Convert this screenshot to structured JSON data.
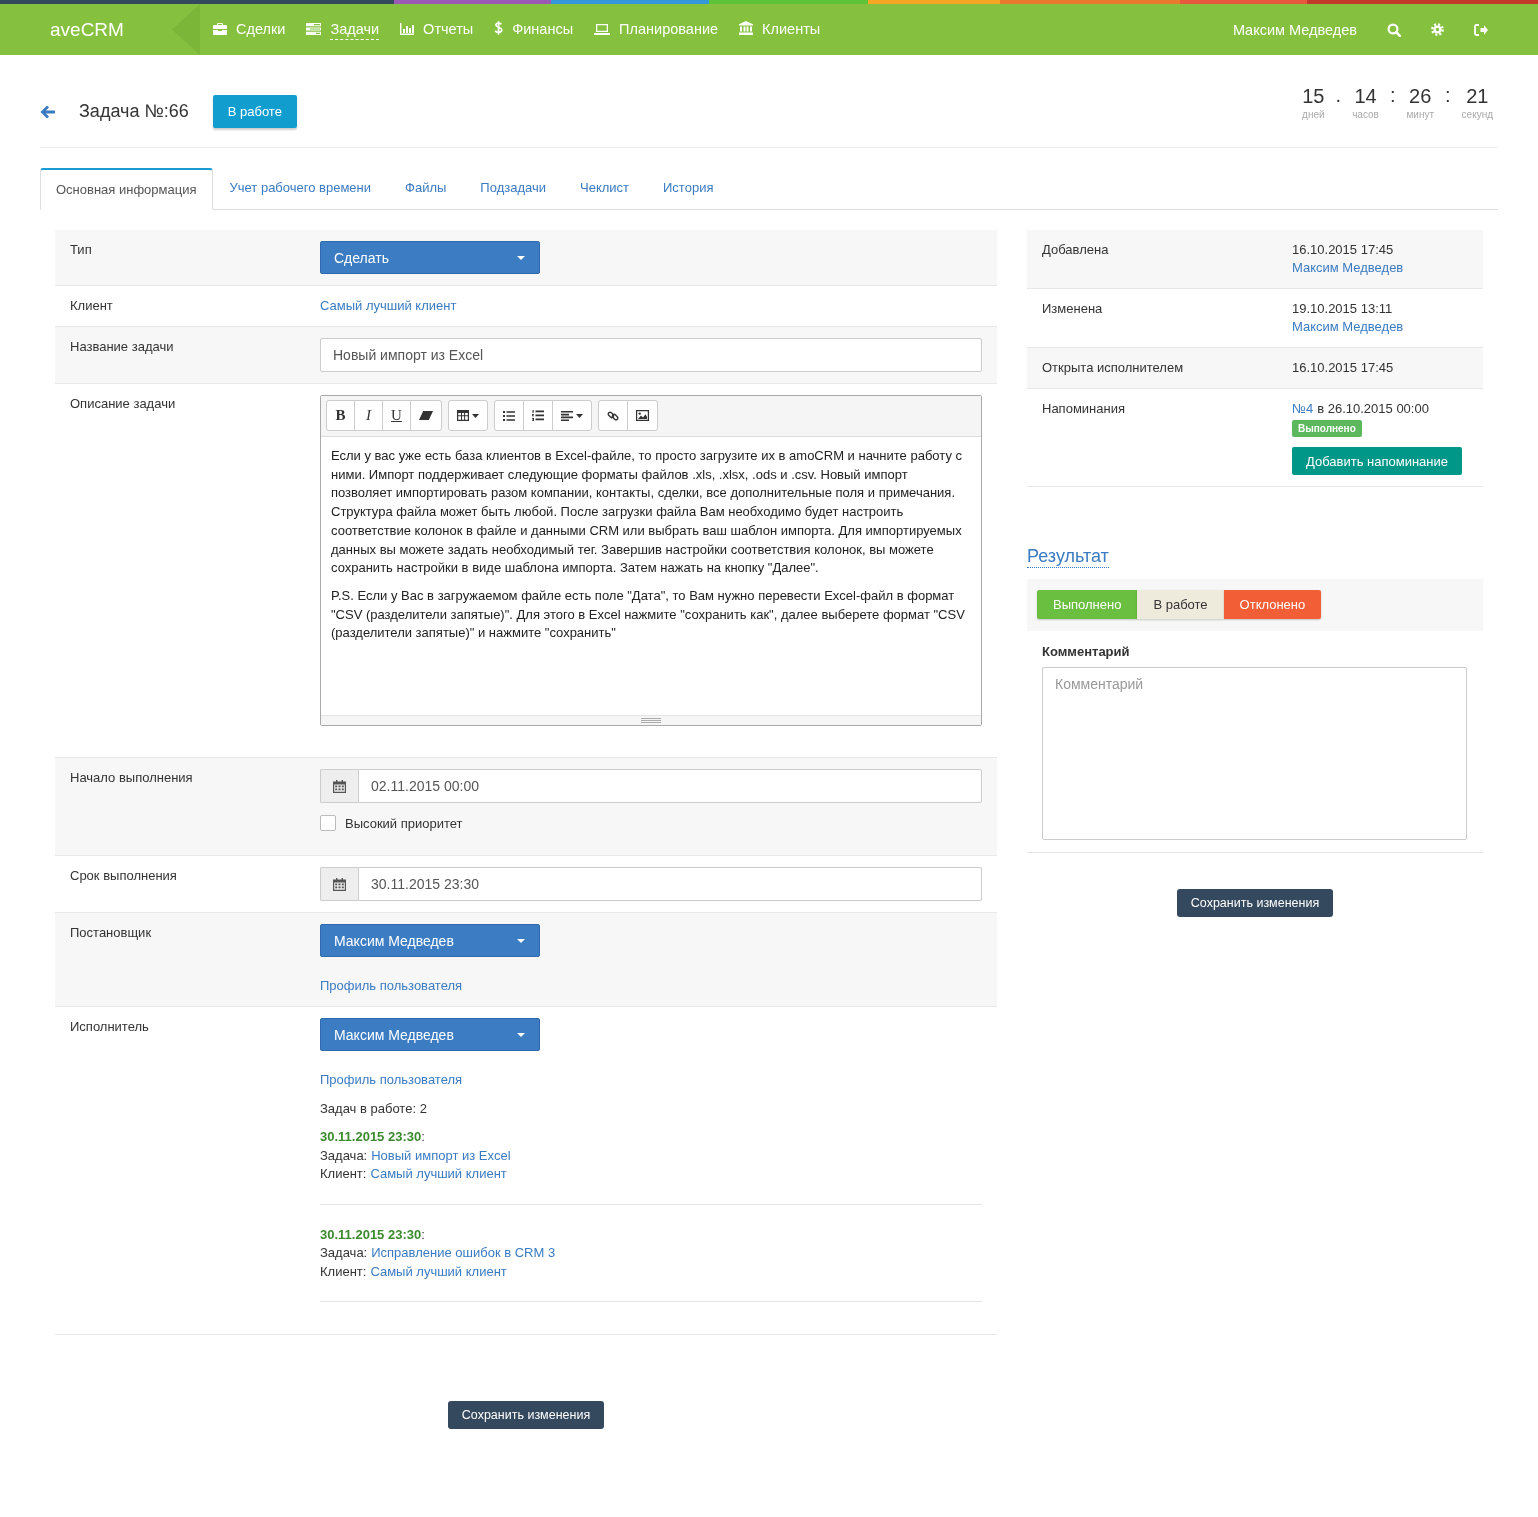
{
  "topbar": {
    "logo": "aveCRM",
    "nav": [
      {
        "label": "Сделки",
        "selected": false
      },
      {
        "label": "Задачи",
        "selected": true
      },
      {
        "label": "Отчеты",
        "selected": false
      },
      {
        "label": "Финансы",
        "selected": false
      },
      {
        "label": "Планирование",
        "selected": false
      },
      {
        "label": "Клиенты",
        "selected": false
      }
    ],
    "user": "Максим Медведев"
  },
  "header": {
    "title": "Задача №:66",
    "status_button": "В работе",
    "countdown": [
      {
        "value": "15",
        "unit": "дней"
      },
      {
        "separator": ".",
        "value": "14",
        "unit": "часов"
      },
      {
        "separator": ":",
        "value": "26",
        "unit": "минут"
      },
      {
        "separator": ":",
        "value": "21",
        "unit": "секунд"
      }
    ]
  },
  "tabs": [
    {
      "label": "Основная информация",
      "selected": true
    },
    {
      "label": "Учет рабочего времени",
      "selected": false
    },
    {
      "label": "Файлы",
      "selected": false
    },
    {
      "label": "Подзадачи",
      "selected": false
    },
    {
      "label": "Чеклист",
      "selected": false
    },
    {
      "label": "История",
      "selected": false
    }
  ],
  "task_form": {
    "rows": [
      {
        "kind": "select",
        "label": "Тип",
        "value": "Сделать"
      },
      {
        "kind": "link",
        "label": "Клиент",
        "value": "Самый лучший клиент"
      },
      {
        "kind": "input",
        "label": "Название задачи",
        "value": "Новый импорт из Excel"
      },
      {
        "kind": "editor",
        "label": "Описание задачи",
        "toolbar_letters": [
          "B",
          "I",
          "U"
        ],
        "paragraphs": [
          "Если у вас уже есть база клиентов в Excel-файле, то просто загрузите их в amoCRM и начните работу с ними. Импорт поддерживает следующие форматы файлов .xls, .xlsx, .ods и .csv. Новый импорт позволяет импортировать разом компании, контакты, сделки, все дополнительные поля и примечания. Структура файла может быть любой. После загрузки файла Вам необходимо будет настроить соответствие колонок в файле и данными CRM или выбрать ваш шаблон импорта. Для импортируемых данных вы можете задать необходимый тег. Завершив настройки соответствия колонок, вы можете сохранить настройки в виде шаблона импорта. Затем нажать на кнопку \"Далее\".",
          "P.S. Если у Вас в загружаемом файле есть поле \"Дата\", то Вам нужно перевести Excel-файл в формат \"CSV (разделители запятые)\". Для этого в Excel нажмите \"сохранить как\", далее выберете формат \"CSV (разделители запятые)\" и нажмите \"сохранить\""
        ]
      },
      {
        "kind": "date",
        "label": "Начало выполнения",
        "value": "02.11.2015 00:00",
        "checkbox": {
          "label": "Высокий приоритет",
          "checked": false
        }
      },
      {
        "kind": "date",
        "label": "Срок выполнения",
        "value": "30.11.2015 23:30"
      },
      {
        "kind": "user",
        "label": "Постановщик",
        "value": "Максим Медведев",
        "profile_link": "Профиль пользователя"
      },
      {
        "kind": "user",
        "label": "Исполнитель",
        "value": "Максим Медведев",
        "profile_link": "Профиль пользователя",
        "workload": "Задач в работе: 2",
        "tasks": [
          {
            "due": "**30.11.2015 23:30**:",
            "task_label": "Задача:",
            "task": "Новый импорт из Excel",
            "client_label": "Клиент:",
            "client": "Самый лучший клиент"
          },
          {
            "due": "**30.11.2015 23:30**:",
            "task_label": "Задача:",
            "task": "Исправление ошибок в CRM 3",
            "client_label": "Клиент:",
            "client": "Самый лучший клиент"
          }
        ]
      }
    ],
    "save_button": "Сохранить изменения"
  },
  "details": {
    "rows": [
      {
        "label": "Добавлена",
        "date": "16.10.2015 17:45",
        "user": "Максим Медведев"
      },
      {
        "label": "Изменена",
        "date": "19.10.2015 13:11",
        "user": "Максим Медведев"
      },
      {
        "label": "Открыта исполнителем",
        "date": "16.10.2015 17:45"
      },
      {
        "label": "Напоминания",
        "reminder": {
          "link": "№4",
          "text": "в 26.10.2015 00:00",
          "badge": "Выполнено"
        },
        "add_button": "Добавить напоминание"
      }
    ]
  },
  "result": {
    "title": "Результат",
    "options": [
      {
        "label": "Выполнено",
        "color": "#6abf40"
      },
      {
        "label": "В работе",
        "color": "#efebdc"
      },
      {
        "label": "Отклонено",
        "color": "#f25f36"
      }
    ],
    "comment": {
      "label": "Комментарий",
      "placeholder": "Комментарий"
    },
    "save_button": "Сохранить изменения"
  }
}
